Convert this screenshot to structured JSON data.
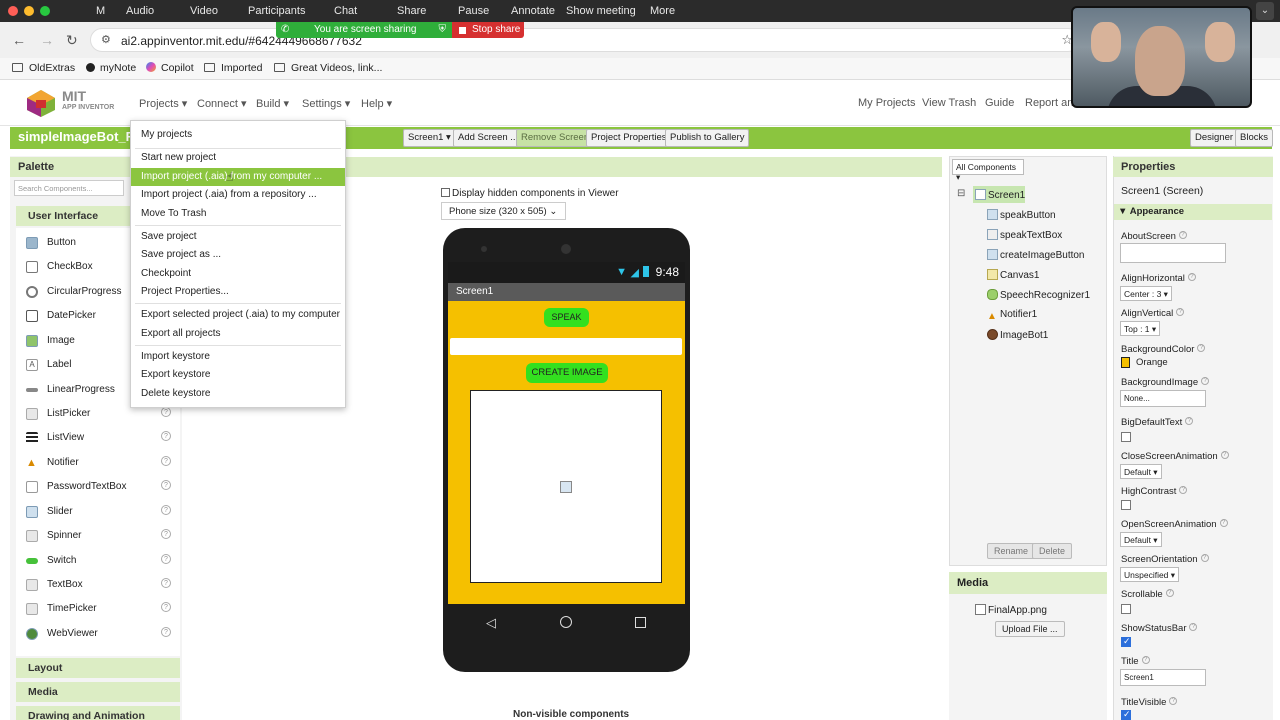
{
  "zoom": {
    "app_title": "M",
    "items": [
      "Audio",
      "Video",
      "Participants",
      "Chat",
      "Share",
      "Pause",
      "Annotate",
      "Show meeting",
      "More"
    ],
    "sharing_text": "You are screen sharing",
    "stop_share": "Stop share"
  },
  "browser": {
    "url": "ai2.appinventor.mit.edu/#6424449668677632",
    "bookmarks": [
      "OldExtras",
      "myNote",
      "Copilot",
      "Imported",
      "Great Videos, link..."
    ]
  },
  "nav": {
    "logo_text": "MIT",
    "logo_sub": "APP INVENTOR",
    "menus": [
      "Projects ▾",
      "Connect ▾",
      "Build ▾",
      "Settings ▾",
      "Help ▾"
    ],
    "links": [
      "My Projects",
      "View Trash",
      "Guide",
      "Report an I"
    ]
  },
  "toolbar": {
    "project_name": "simpleImageBot_F",
    "screen_select": "Screen1 ▾",
    "add_screen": "Add Screen ...",
    "remove_screen": "Remove Screen",
    "project_properties": "Project Properties",
    "publish": "Publish to Gallery",
    "designer": "Designer",
    "blocks": "Blocks"
  },
  "projects_menu": {
    "items": [
      "My projects",
      "Start new project",
      "Import project (.aia) from my computer ...",
      "Import project (.aia) from a repository ...",
      "Move To Trash",
      "Save project",
      "Save project as ...",
      "Checkpoint",
      "Project Properties...",
      "Export selected project (.aia) to my computer",
      "Export all projects",
      "Import keystore",
      "Export keystore",
      "Delete keystore"
    ]
  },
  "palette": {
    "title": "Palette",
    "search_placeholder": "Search Components...",
    "category_ui": "User Interface",
    "items": [
      "Button",
      "CheckBox",
      "CircularProgress",
      "DatePicker",
      "Image",
      "Label",
      "LinearProgress",
      "ListPicker",
      "ListView",
      "Notifier",
      "PasswordTextBox",
      "Slider",
      "Spinner",
      "Switch",
      "TextBox",
      "TimePicker",
      "WebViewer"
    ],
    "categories_bottom": [
      "Layout",
      "Media",
      "Drawing and Animation"
    ]
  },
  "viewer": {
    "hidden_label": "Display hidden components in Viewer",
    "phone_size": "Phone size (320 x 505)  ⌄",
    "clock": "9:48",
    "screen_title": "Screen1",
    "speak_label": "SPEAK",
    "create_label": "CREATE IMAGE",
    "nonvisible": "Non-visible components"
  },
  "components": {
    "dropdown": "All Components ▾",
    "items": [
      "Screen1",
      "speakButton",
      "speakTextBox",
      "createImageButton",
      "Canvas1",
      "SpeechRecognizer1",
      "Notifier1",
      "ImageBot1"
    ],
    "rename": "Rename",
    "delete": "Delete"
  },
  "media": {
    "title": "Media",
    "file": "FinalApp.png",
    "upload": "Upload File ..."
  },
  "properties": {
    "title": "Properties",
    "subject": "Screen1 (Screen)",
    "section": "Appearance",
    "about": "AboutScreen",
    "align_h": "AlignHorizontal",
    "align_h_val": "Center : 3 ▾",
    "align_v": "AlignVertical",
    "align_v_val": "Top : 1 ▾",
    "bgcolor": "BackgroundColor",
    "bgcolor_val": "Orange",
    "bgimage": "BackgroundImage",
    "bgimage_val": "None...",
    "bigtext": "BigDefaultText",
    "close_anim": "CloseScreenAnimation",
    "close_anim_val": "Default ▾",
    "high_contrast": "HighContrast",
    "open_anim": "OpenScreenAnimation",
    "open_anim_val": "Default ▾",
    "orientation": "ScreenOrientation",
    "orientation_val": "Unspecified ▾",
    "scrollable": "Scrollable",
    "statusbar": "ShowStatusBar",
    "title_label": "Title",
    "title_val": "Screen1",
    "title_visible": "TitleVisible"
  },
  "colors": {
    "ai_green": "#8bc53f",
    "screen_orange": "#f5c000",
    "button_green": "#33e01f"
  }
}
